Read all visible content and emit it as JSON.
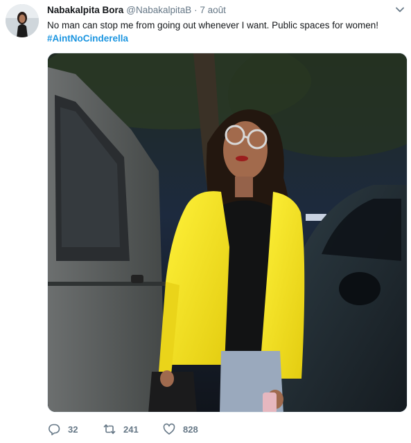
{
  "tweet": {
    "author_name": "Nabakalpita Bora",
    "author_handle": "@NabakalpitaB",
    "separator": "·",
    "date": "7 août",
    "text": "No man can stop me from going out whenever I want. Public spaces for women!",
    "hashtag": "#AintNoCinderella"
  },
  "icons": {
    "avatar": "avatar",
    "caret": "chevron-down-icon",
    "reply": "reply-icon",
    "retweet": "retweet-icon",
    "like": "heart-icon"
  },
  "actions": {
    "reply_count": "32",
    "retweet_count": "241",
    "like_count": "828"
  },
  "colors": {
    "link": "#1b95e0",
    "secondary_text": "#657786",
    "primary_text": "#14171a"
  }
}
